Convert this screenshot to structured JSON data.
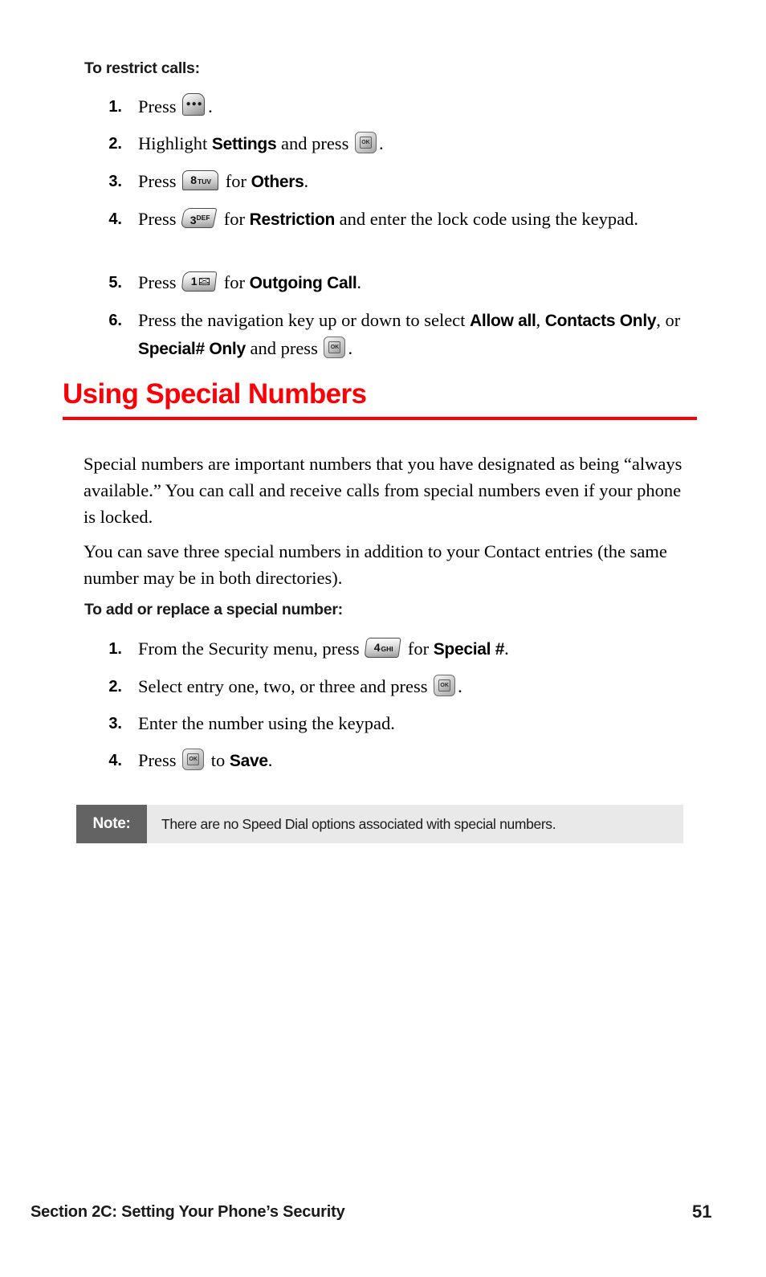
{
  "page": {
    "number": "51",
    "footer_section": "Section 2C: Setting Your Phone’s Security"
  },
  "procedure_restrict": {
    "heading": "To restrict calls:",
    "steps": [
      {
        "num": "1.",
        "pre": "Press ",
        "key": "menu-key",
        "post": "."
      },
      {
        "num": "2.",
        "pre": "Highlight ",
        "bold1": "Settings",
        "mid": " and press ",
        "key": "ok-key",
        "post": "."
      },
      {
        "num": "3.",
        "pre": "Press ",
        "key": "key-8-tuv",
        "mid": " for ",
        "bold1": "Others",
        "post": "."
      },
      {
        "num": "4.",
        "pre": "Press ",
        "key": "key-3-def",
        "mid": " for ",
        "bold1": "Restriction",
        "post": " and enter the lock code using the keypad."
      },
      {
        "num": "5.",
        "pre": "Press ",
        "key": "key-1-voicemail",
        "mid": " for ",
        "bold1": "Outgoing Call",
        "post": "."
      },
      {
        "num": "6.",
        "pre": "Press the navigation key up or down to select ",
        "bold1": "Allow all",
        "mid": ", ",
        "bold2": "Contacts Only",
        "mid2": ", or ",
        "bold3": "Special# Only",
        "mid3": " and press ",
        "key": "ok-key",
        "post": "."
      }
    ]
  },
  "section": {
    "title": "Using Special Numbers",
    "title_color": "#fb0007",
    "paragraphs": [
      "Special numbers are important numbers that you have designated as being “always available.” You can call and receive calls from special numbers even if your phone is locked.",
      "You can save three special numbers in addition to your Contact entries (the same number may be in both directories)."
    ]
  },
  "procedure_special": {
    "heading": "To add or replace a special number:",
    "steps": [
      {
        "num": "1.",
        "pre": "From the Security menu, press ",
        "key": "key-4-ghi",
        "mid": " for ",
        "bold1": "Special #",
        "post": "."
      },
      {
        "num": "2.",
        "pre": "Select entry one, two, or three and press ",
        "key": "ok-key",
        "post": "."
      },
      {
        "num": "3.",
        "pre": "Enter the number using the keypad.",
        "key": "",
        "post": ""
      },
      {
        "num": "4.",
        "pre": "Press ",
        "key": "ok-key",
        "mid": " to ",
        "bold1": "Save",
        "post": "."
      }
    ]
  },
  "note": {
    "label": "Note:",
    "text": "There are no Speed Dial options associated with special numbers.",
    "label_bg": "#636363",
    "body_bg": "#e9e9e9"
  },
  "keys": {
    "menu": {
      "glyph": "●●●",
      "name": "menu-key"
    },
    "ok": {
      "label": "OK",
      "name": "ok-key"
    },
    "k8": {
      "digit": "8",
      "letters": "TUV"
    },
    "k3": {
      "digit": "3",
      "letters": "DEF"
    },
    "k1": {
      "digit": "1",
      "letters": ""
    },
    "k4": {
      "digit": "4",
      "letters": "GHI"
    }
  }
}
